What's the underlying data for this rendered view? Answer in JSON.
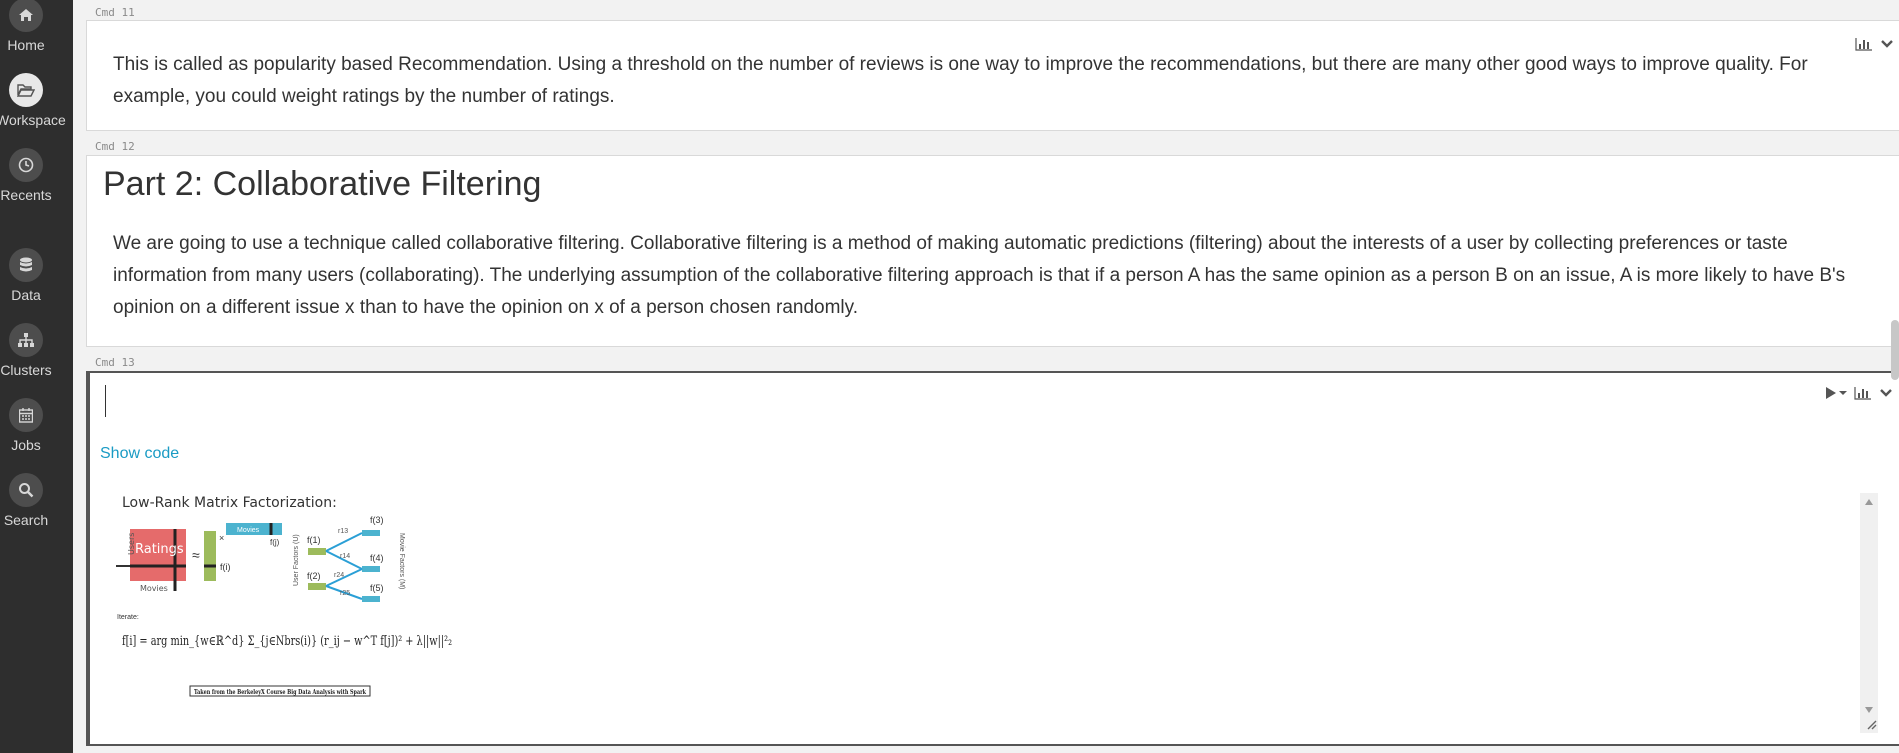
{
  "sidebar": {
    "items": [
      {
        "label": "Home",
        "icon": "home-icon"
      },
      {
        "label": "Workspace",
        "icon": "folder-open-icon"
      },
      {
        "label": "Recents",
        "icon": "clock-icon"
      },
      {
        "label": "Data",
        "icon": "database-icon"
      },
      {
        "label": "Clusters",
        "icon": "sitemap-icon"
      },
      {
        "label": "Jobs",
        "icon": "calendar-icon"
      },
      {
        "label": "Search",
        "icon": "search-icon"
      }
    ],
    "active": "Workspace"
  },
  "cells": {
    "cmd11": {
      "label": "Cmd 11",
      "text": "This is called as popularity based Recommendation. Using a threshold on the number of reviews is one way to improve the recommendations, but there are many other good ways to improve quality. For example, you could weight ratings by the number of ratings."
    },
    "cmd12": {
      "label": "Cmd 12",
      "heading": "Part 2: Collaborative Filtering",
      "text": "We are going to use a technique called collaborative filtering. Collaborative filtering is a method of making automatic predictions (filtering) about the interests of a user by collecting preferences or taste information from many users (collaborating). The underlying assumption of the collaborative filtering approach is that if a person A has the same opinion as a person B on an issue, A is more likely to have B's opinion on a different issue x than to have the opinion on x of a person chosen randomly."
    },
    "cmd13": {
      "label": "Cmd 13",
      "show_code": "Show code",
      "figure": {
        "title": "Low-Rank Matrix Factorization:",
        "ratings_label": "Ratings",
        "users_label": "Users",
        "movies_label": "Movies",
        "movies_bar_label": "Movies",
        "f_i": "f(i)",
        "f_j": "f(j)",
        "approx": "≈",
        "times": "×",
        "user_factors": "User Factors (U)",
        "movie_factors": "Movie Factors (M)",
        "nodes_left": [
          "f(1)",
          "f(2)"
        ],
        "nodes_right": [
          "f(3)",
          "f(4)",
          "f(5)"
        ],
        "edges": [
          "r13",
          "r14",
          "r24",
          "r25"
        ],
        "iterate": "Iterate:",
        "formula": "f[i] = arg min_{w∈ℝ^d} Σ_{j∈Nbrs(i)} (r_ij − w^T f[j])² + λ||w||²₂",
        "credit": "Taken from the BerkeleyX Course Big Data Analysis with Spark"
      }
    }
  },
  "colors": {
    "sidebar_bg": "#2e2e2e",
    "link": "#1a9bc4",
    "ratings": "#e56b6b",
    "user_factor": "#9dbb5c",
    "movie_factor": "#4cb3cf",
    "edge": "#2a9fd6"
  }
}
